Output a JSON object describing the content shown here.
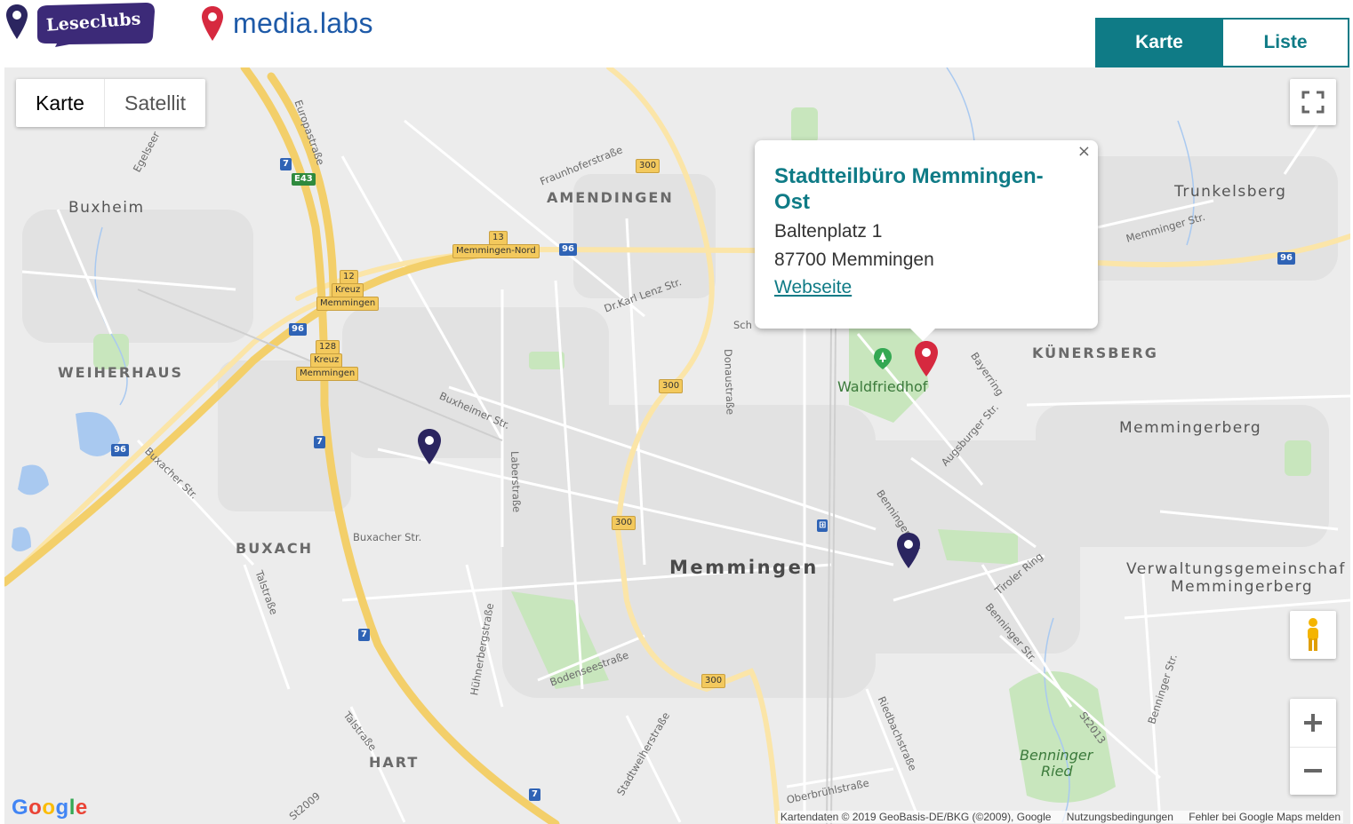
{
  "header": {
    "brand_leseclubs": "Leseclubs",
    "brand_medialabs": "media.labs",
    "view_toggle": {
      "active": "Karte",
      "inactive": "Liste"
    }
  },
  "map": {
    "map_type": {
      "active": "Karte",
      "inactive": "Satellit"
    },
    "labels": {
      "buxheim": "Buxheim",
      "amendingen": "AMENDINGEN",
      "trunkelsberg": "Trunkelsberg",
      "weiherhaus": "WEIHERHAUS",
      "kunersberg": "KÜNERSBERG",
      "memmingerberg": "Memmingerberg",
      "buxach": "BUXACH",
      "memmingen": "Memmingen",
      "vg1": "Verwaltungsgemeinschaf",
      "vg2": "Memmingerberg",
      "hart": "HART",
      "benninger_ried1": "Benninger",
      "benninger_ried2": "Ried",
      "waldfriedhof": "Waldfriedhof"
    },
    "streets": {
      "europastrasse": "Europastraße",
      "egelseer": "Egelseer",
      "fraunhoferstrasse": "Fraunhoferstraße",
      "dr_karl_lenz": "Dr.Karl Lenz Str.",
      "memminger_str": "Memminger Str.",
      "buxheimer_str": "Buxheimer Str.",
      "laberstrasse": "Laberstraße",
      "donaustrasse": "Donaustraße",
      "bayerring": "Bayerring",
      "augsburger_str": "Augsburger Str.",
      "buxacher_str_1": "Buxacher Str.",
      "buxacher_str_2": "Buxacher Str.",
      "talstrasse_1": "Talstraße",
      "talstrasse_2": "Talstraße",
      "benninger_str_1": "Benninger Str.",
      "benninger_str_2": "Benninger Str.",
      "benninger_str_3": "Benninger Str.",
      "tiroler_ring": "Tiroler Ring",
      "huhnerbergstrasse": "Hühnerbergstraße",
      "bodenseestrasse": "Bodenseestraße",
      "stadtweiherstrasse": "Stadtweiherstraße",
      "riedbachstrasse": "Riedbachstraße",
      "oberbruhlstrasse": "Oberbrühlstraße",
      "st2013": "St2013",
      "st2009": "St2009",
      "sch": "Sch"
    },
    "shields": {
      "a7_1": "7",
      "e43": "E43",
      "a7_2": "7",
      "a7_3": "7",
      "a7_4": "7",
      "a96_1": "96",
      "a96_2": "96",
      "a96_3": "96",
      "a96_4": "96",
      "b300_1": "300",
      "b300_2": "300",
      "b300_3": "300",
      "b300_4": "300",
      "exit13": "13",
      "exit_memmingen_nord": "Memmingen-Nord",
      "exit12": "12",
      "kreuz1": "Kreuz",
      "kreuz1_name": "Memmingen",
      "exit128": "128",
      "kreuz2": "Kreuz",
      "kreuz2_name": "Memmingen"
    },
    "popup": {
      "title": "Stadtteilbüro Memmingen-Ost",
      "address_line1": "Baltenplatz 1",
      "address_line2": "87700 Memmingen",
      "link": "Webseite",
      "close": "×"
    },
    "attribution": {
      "data": "Kartendaten © 2019 GeoBasis-DE/BKG (©2009), Google",
      "terms": "Nutzungsbedingungen",
      "report": "Fehler bei Google Maps melden"
    },
    "google_logo": {
      "G": "G",
      "o1": "o",
      "o2": "o",
      "g": "g",
      "l": "l",
      "e": "e"
    },
    "colors": {
      "accent": "#0f7b86",
      "marker_primary": "#2b2560",
      "marker_active": "#d6293f",
      "motorway": "#f3cf6a",
      "map_bg": "#ececec"
    }
  }
}
